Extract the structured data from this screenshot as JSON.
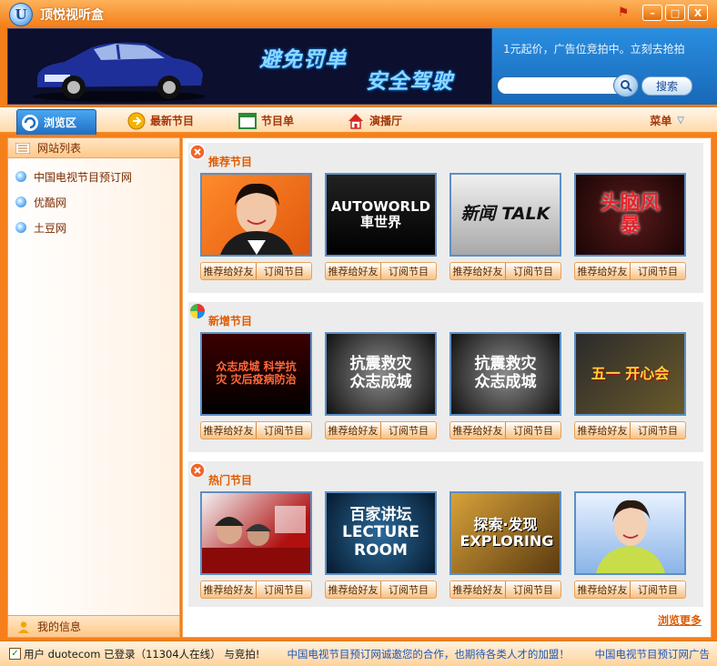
{
  "window": {
    "title": "顶悦视听盒",
    "logo_letter": "U"
  },
  "banner": {
    "slogan_line1": "避免罚单",
    "slogan_line2": "安全驾驶"
  },
  "search": {
    "ad_text": "1元起价，广告位竞拍中。立刻去抢拍",
    "placeholder": "",
    "button_label": "搜索"
  },
  "nav": {
    "items": [
      {
        "label": "浏览区"
      },
      {
        "label": "最新节目"
      },
      {
        "label": "节目单"
      },
      {
        "label": "演播厅"
      }
    ],
    "menu_label": "菜单"
  },
  "sidebar": {
    "header": "网站列表",
    "items": [
      {
        "label": "中国电视节目预订网"
      },
      {
        "label": "优酷网"
      },
      {
        "label": "土豆网"
      }
    ],
    "footer": "我的信息"
  },
  "sections": [
    {
      "title": "推荐节目",
      "cards": [
        {
          "art": "",
          "recommend": "推荐给好友",
          "subscribe": "订阅节目"
        },
        {
          "art": "AUTOWORLD 車世界",
          "recommend": "推荐给好友",
          "subscribe": "订阅节目"
        },
        {
          "art": "新闻 TALK",
          "recommend": "推荐给好友",
          "subscribe": "订阅节目"
        },
        {
          "art": "头脑风暴",
          "recommend": "推荐给好友",
          "subscribe": "订阅节目"
        }
      ]
    },
    {
      "title": "新增节目",
      "cards": [
        {
          "art": "众志成城 科学抗灾 灾后疫病防治",
          "recommend": "推荐给好友",
          "subscribe": "订阅节目"
        },
        {
          "art": "抗震救灾 众志成城",
          "recommend": "推荐给好友",
          "subscribe": "订阅节目"
        },
        {
          "art": "抗震救灾 众志成城",
          "recommend": "推荐给好友",
          "subscribe": "订阅节目"
        },
        {
          "art": "五一 开心会",
          "recommend": "推荐给好友",
          "subscribe": "订阅节目"
        }
      ]
    },
    {
      "title": "热门节目",
      "cards": [
        {
          "art": "",
          "recommend": "推荐给好友",
          "subscribe": "订阅节目"
        },
        {
          "art": "百家讲坛 LECTURE ROOM",
          "recommend": "推荐给好友",
          "subscribe": "订阅节目"
        },
        {
          "art": "探索·发现 EXPLORING",
          "recommend": "推荐给好友",
          "subscribe": "订阅节目"
        },
        {
          "art": "",
          "recommend": "推荐给好友",
          "subscribe": "订阅节目"
        }
      ]
    }
  ],
  "more_link": "浏览更多",
  "status": {
    "user_text": "用户 duotecom 已登录（11304人在线） 与竞拍!",
    "message": "中国电视节目预订网诚邀您的合作，也期待各类人才的加盟！",
    "right_text": "中国电视节目预订网广告"
  },
  "colors": {
    "accent_orange": "#f57f1a",
    "nav_active_blue": "#1f6fc4",
    "section_title": "#e05a00"
  }
}
